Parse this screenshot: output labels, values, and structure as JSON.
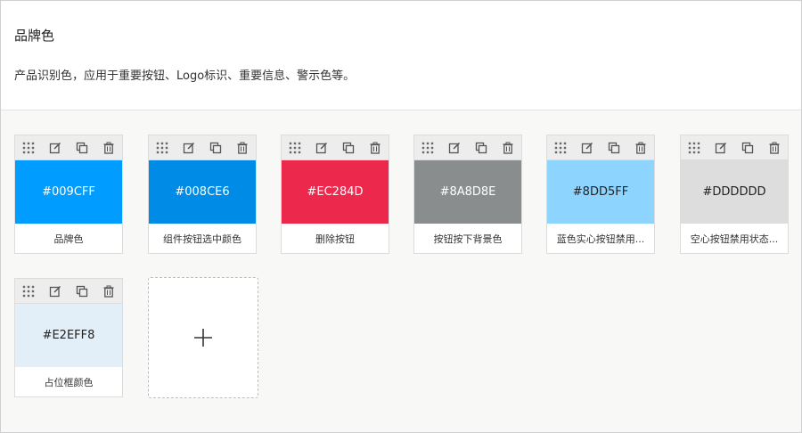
{
  "section": {
    "title": "品牌色",
    "description": "产品识别色，应用于重要按钮、Logo标识、重要信息、警示色等。"
  },
  "toolbar_icons": [
    "drag-grip-icon",
    "edit-icon",
    "copy-icon",
    "delete-icon"
  ],
  "colors": [
    {
      "hex": "#009CFF",
      "label": "品牌色",
      "text_tone": "dark"
    },
    {
      "hex": "#008CE6",
      "label": "组件按钮选中颜色",
      "text_tone": "dark"
    },
    {
      "hex": "#EC284D",
      "label": "删除按钮",
      "text_tone": "dark"
    },
    {
      "hex": "#8A8D8E",
      "label": "按钮按下背景色",
      "text_tone": "dark"
    },
    {
      "hex": "#8DD5FF",
      "label": "蓝色实心按钮禁用...",
      "text_tone": "light"
    },
    {
      "hex": "#DDDDDD",
      "label": "空心按钮禁用状态...",
      "text_tone": "light"
    },
    {
      "hex": "#E2EFF8",
      "label": "占位框颜色",
      "text_tone": "light"
    }
  ],
  "add_button": {
    "icon": "plus-icon"
  }
}
